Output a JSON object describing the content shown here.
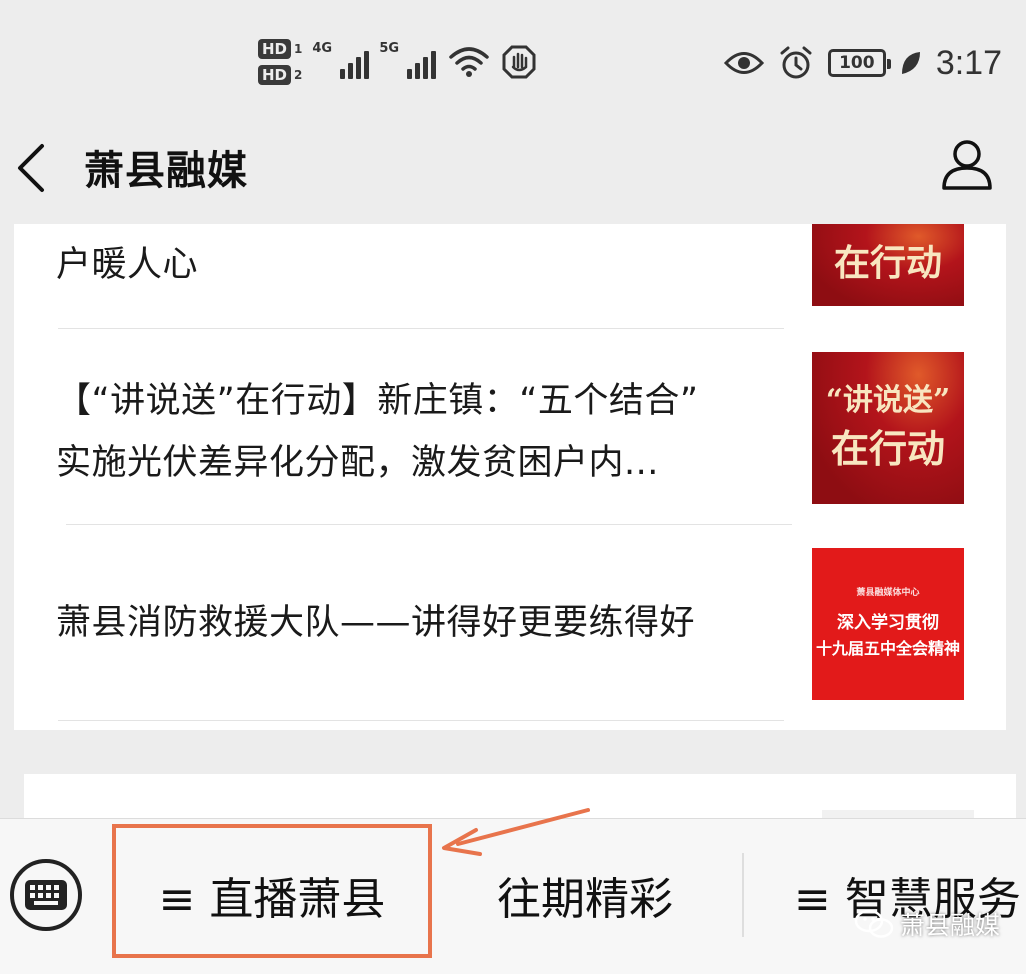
{
  "status_bar": {
    "hd1": "HD",
    "hd1_sub": "1",
    "hd2": "HD",
    "hd2_sub": "2",
    "net1": "4G",
    "net2": "5G",
    "battery": "100",
    "time": "3:17",
    "icons": [
      "signal-icon",
      "wifi-icon",
      "hand-icon",
      "eye-icon",
      "alarm-icon",
      "battery-icon",
      "leaf-icon"
    ]
  },
  "nav": {
    "title": "萧县融媒",
    "back_icon": "chevron-left-icon",
    "profile_icon": "person-icon"
  },
  "articles": [
    {
      "title_lines": [
        "户暖人心"
      ],
      "thumb": {
        "lines": [
          "在行动"
        ]
      }
    },
    {
      "title_lines": [
        "【“讲说送”在行动】新庄镇：“五个结合”",
        "实施光伏差异化分配，激发贫困户内..."
      ],
      "thumb": {
        "lines": [
          "“讲说送”",
          "在行动"
        ]
      }
    },
    {
      "title_lines": [
        "萧县消防救援大队——讲得好更要练得好"
      ],
      "thumb": {
        "lines": [
          "萧县融媒体中心",
          "深入学习贯彻",
          "十九届五中全会精神"
        ]
      }
    }
  ],
  "menu": {
    "keyboard_icon": "keyboard-icon",
    "items": [
      {
        "label": "≡ 直播萧县"
      },
      {
        "label": "往期精彩"
      },
      {
        "label": "≡ 智慧服务"
      }
    ]
  },
  "watermark": {
    "text": "萧县融媒",
    "icon": "wechat-icon"
  },
  "colors": {
    "highlight": "#e8744c",
    "thumb_red": "#b3141b",
    "thumb_bright": "#e21a1a"
  }
}
